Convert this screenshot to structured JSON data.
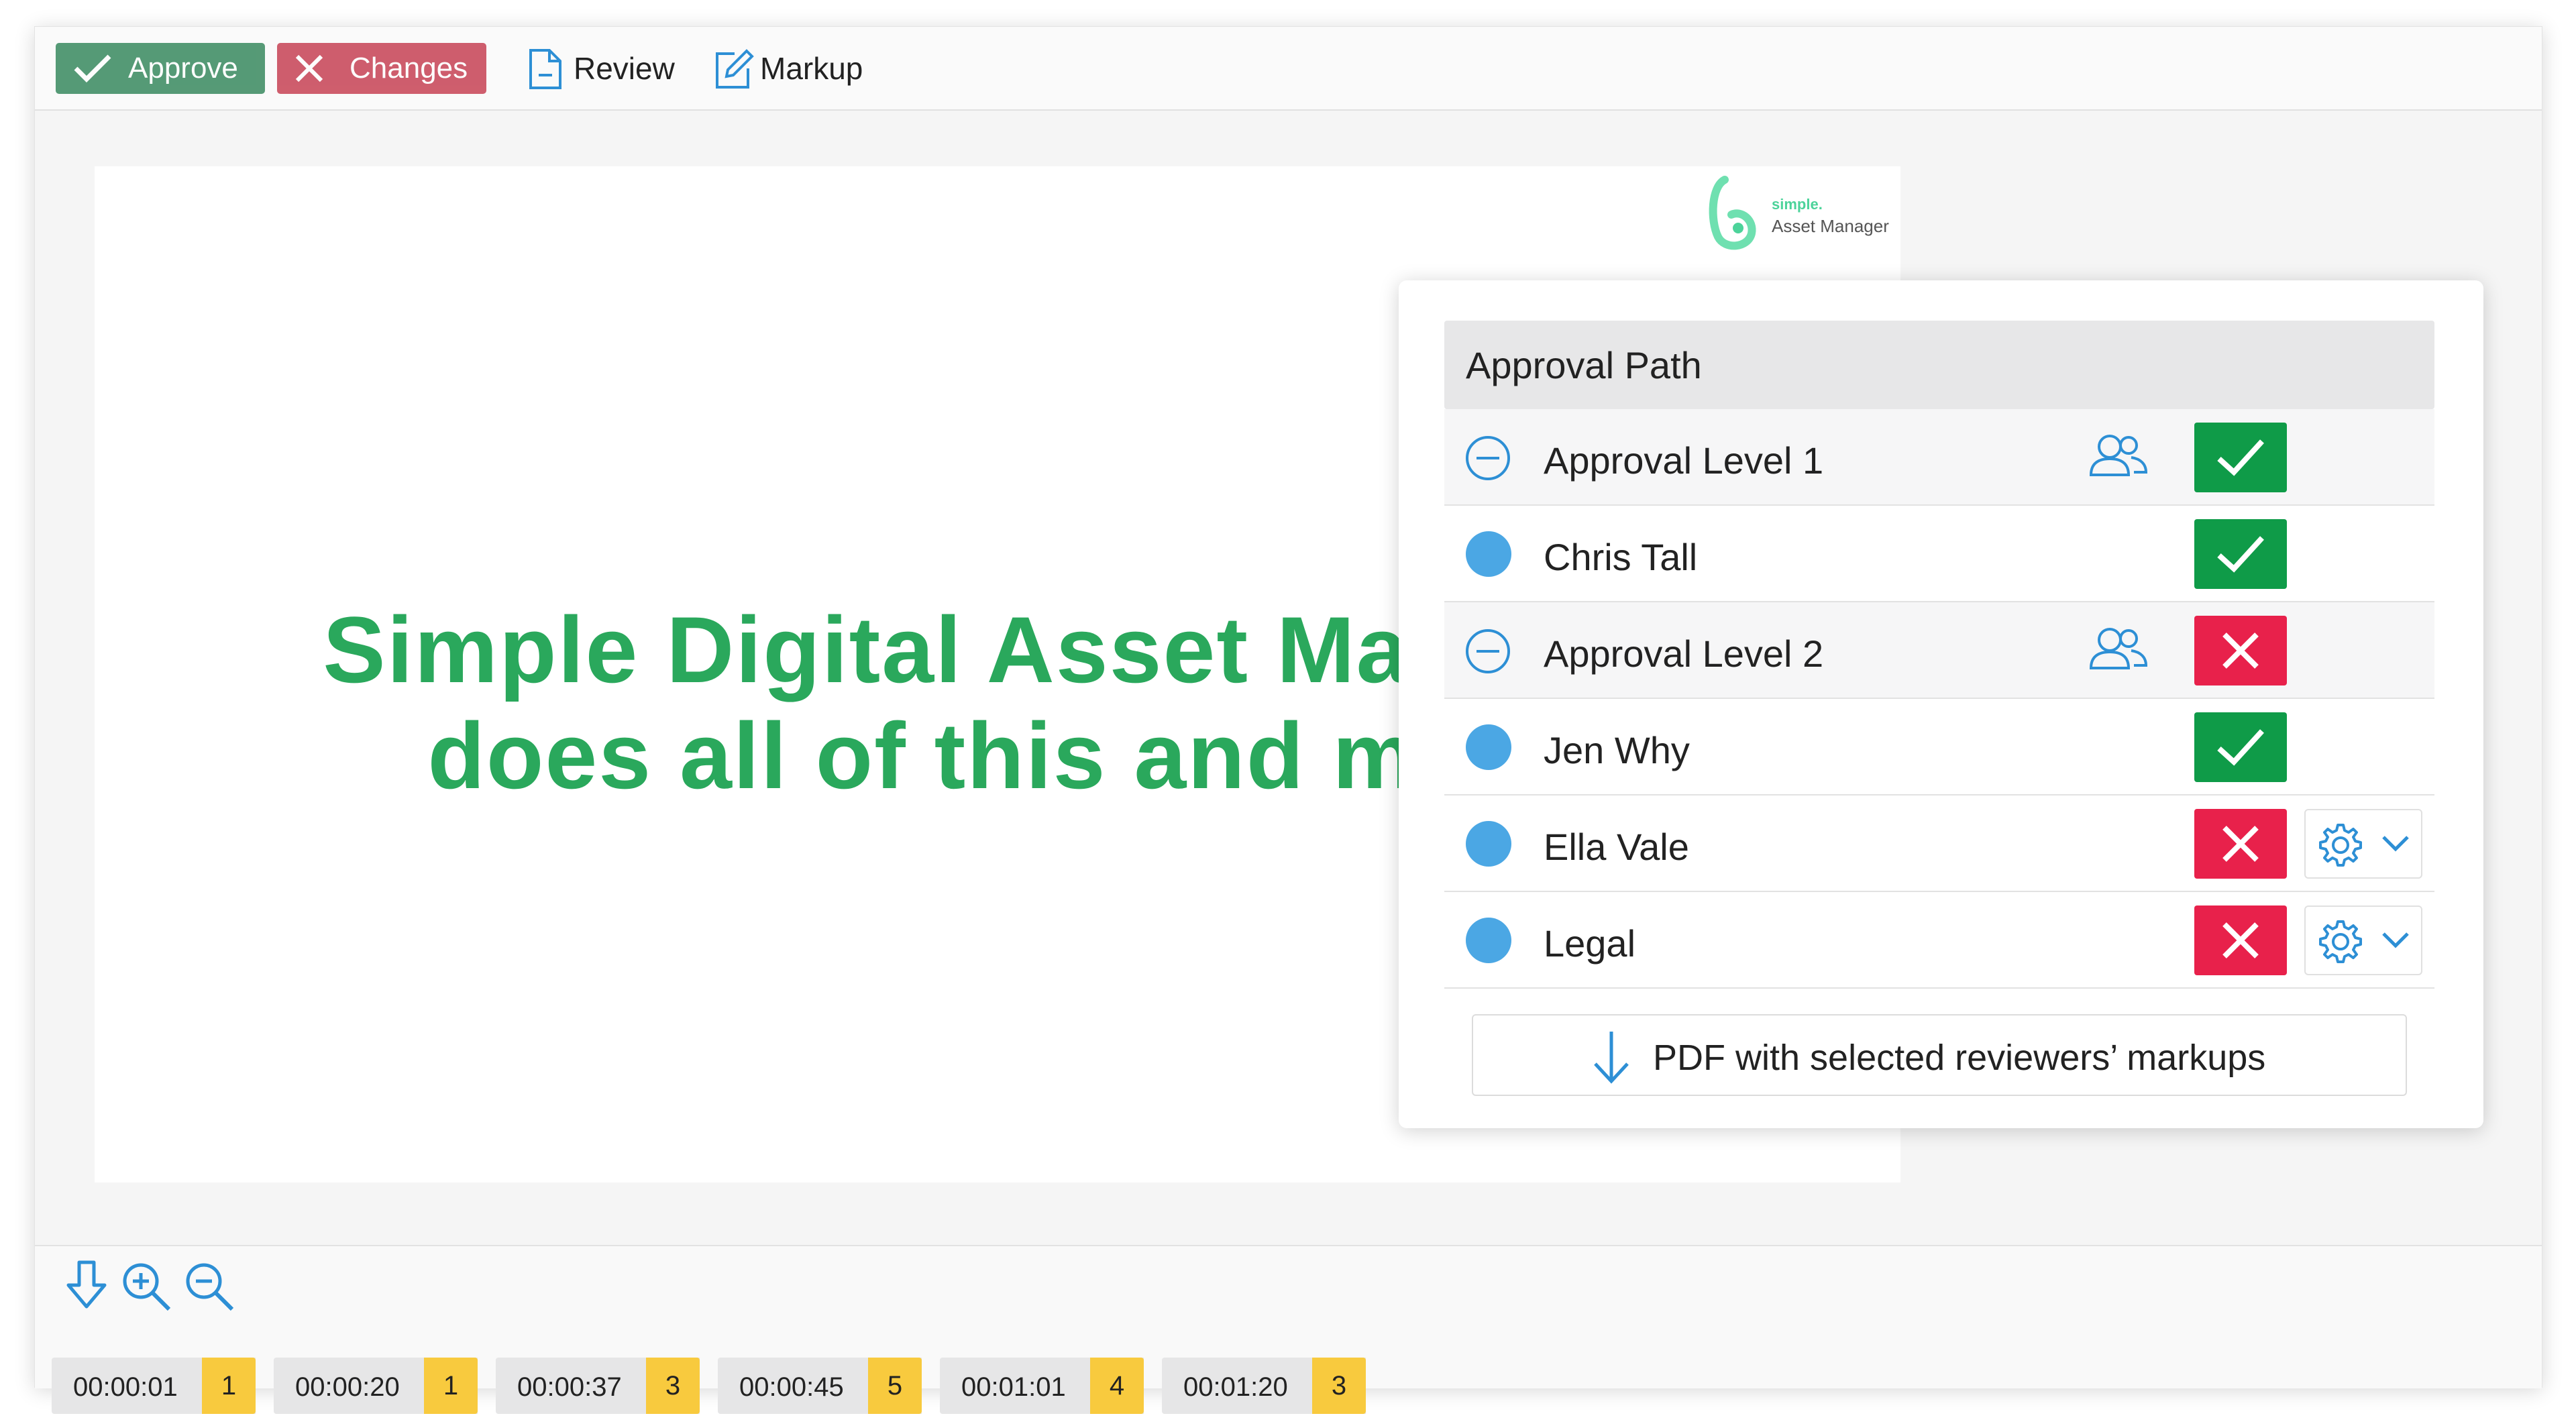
{
  "toolbar": {
    "approve_label": "Approve",
    "changes_label": "Changes",
    "review_label": "Review",
    "markup_label": "Markup",
    "approve_icon": "check-icon",
    "changes_icon": "close-icon",
    "review_icon": "document-icon",
    "markup_icon": "edit-icon"
  },
  "document": {
    "logo_small": "simple.",
    "logo_name": "Asset Manager",
    "headline_line1": "Simple Digital Asset Manager",
    "headline_line2": "does all of this and more",
    "headline_color": "#2aa85c"
  },
  "approval_panel": {
    "title": "Approval Path",
    "rows": [
      {
        "type": "level",
        "label": "Approval Level 1",
        "status": "approved"
      },
      {
        "type": "reviewer",
        "label": "Chris Tall",
        "status": "approved"
      },
      {
        "type": "level",
        "label": "Approval Level 2",
        "status": "rejected"
      },
      {
        "type": "reviewer",
        "label": "Jen Why",
        "status": "approved"
      },
      {
        "type": "reviewer",
        "label": "Ella Vale",
        "status": "rejected",
        "settings": true
      },
      {
        "type": "reviewer",
        "label": "Legal",
        "status": "rejected",
        "settings": true
      }
    ],
    "pdf_button_label": "PDF with selected reviewers’ markups",
    "colors": {
      "approved": "#0f9b48",
      "rejected": "#e8214b",
      "accent": "#4ba7e4"
    }
  },
  "bottom_bar": {
    "icons": [
      "download-icon",
      "zoom-in-icon",
      "zoom-out-icon"
    ],
    "timestamps": [
      {
        "time": "00:00:01",
        "count": "1"
      },
      {
        "time": "00:00:20",
        "count": "1"
      },
      {
        "time": "00:00:37",
        "count": "3"
      },
      {
        "time": "00:00:45",
        "count": "5"
      },
      {
        "time": "00:01:01",
        "count": "4"
      },
      {
        "time": "00:01:20",
        "count": "3"
      }
    ]
  }
}
